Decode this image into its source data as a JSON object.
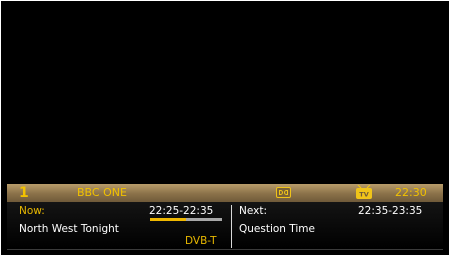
{
  "channel": {
    "number": "1",
    "name": "BBC ONE"
  },
  "clock": "22:30",
  "icons": {
    "audio": "dolby-digital-icon",
    "tv": "tv-icon"
  },
  "now": {
    "label": "Now:",
    "time": "22:25-22:35",
    "title": "North West Tonight",
    "progress": 0.5,
    "source": "DVB-T"
  },
  "next": {
    "label": "Next:",
    "time": "22:35-23:35",
    "title": "Question Time"
  },
  "colors": {
    "accent": "#f2c200",
    "bar": "#8a7149",
    "progress_fill": "#f0b800",
    "progress_track": "#a8a8a8"
  }
}
